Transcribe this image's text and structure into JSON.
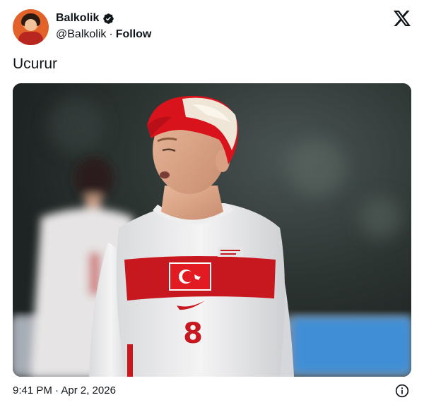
{
  "tweet": {
    "display_name": "Balkolik",
    "handle": "@Balkolik",
    "separator": "·",
    "follow_label": "Follow",
    "text": "Ucurur",
    "timestamp": "9:41 PM · Apr 2, 2026",
    "shirt_number": "8"
  },
  "icons": {
    "verified": "verified-badge-icon",
    "platform": "x-logo-icon",
    "info": "info-icon"
  },
  "colors": {
    "text": "#0f1419",
    "jersey_red": "#c8181f",
    "hair_red": "#d9131c"
  }
}
